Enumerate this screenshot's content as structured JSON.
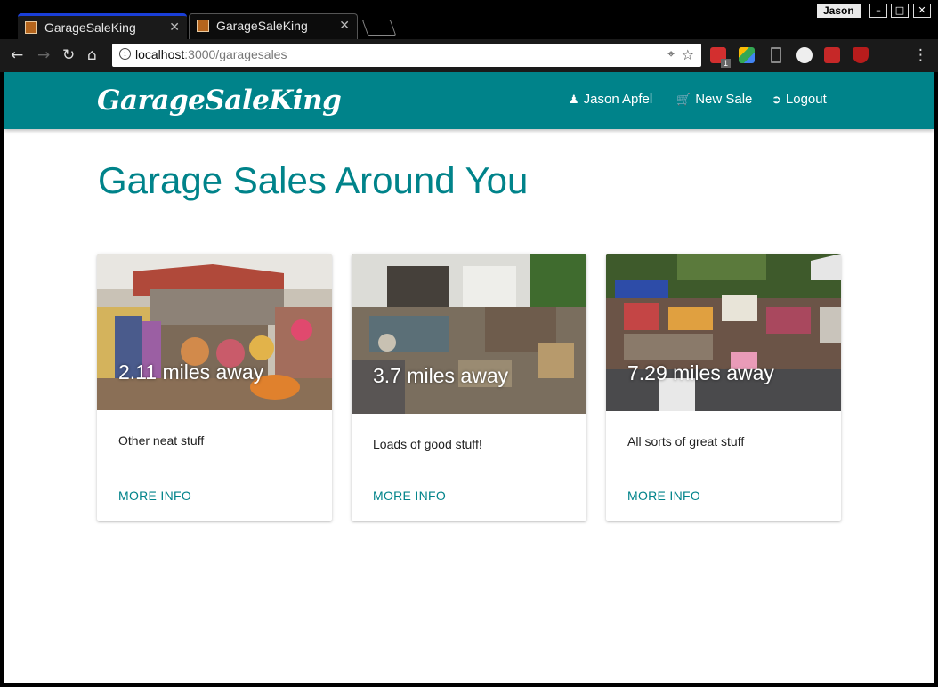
{
  "browser": {
    "tabs": [
      {
        "title": "GarageSaleKing",
        "active": true
      },
      {
        "title": "GarageSaleKing",
        "active": false
      }
    ],
    "profile_name": "Jason",
    "url_host": "localhost",
    "url_path": ":3000/garagesales",
    "extension_badge": "1",
    "colors": {
      "active_tab_accent": "#1a3fd8"
    }
  },
  "navbar": {
    "brand": "GarageSaleKing",
    "links": [
      {
        "label": "Jason Apfel",
        "icon": "user-icon"
      },
      {
        "label": "New Sale",
        "icon": "cart-icon"
      },
      {
        "label": "Logout",
        "icon": "logout-icon"
      }
    ],
    "color": "#00838a"
  },
  "page": {
    "heading": "Garage Sales Around You"
  },
  "cards": [
    {
      "distance": "2.11 miles away",
      "description": "Other neat stuff",
      "action": "MORE INFO"
    },
    {
      "distance": "3.7 miles away",
      "description": "Loads of good stuff!",
      "action": "MORE INFO"
    },
    {
      "distance": "7.29 miles away",
      "description": "All sorts of great stuff",
      "action": "MORE INFO"
    }
  ]
}
